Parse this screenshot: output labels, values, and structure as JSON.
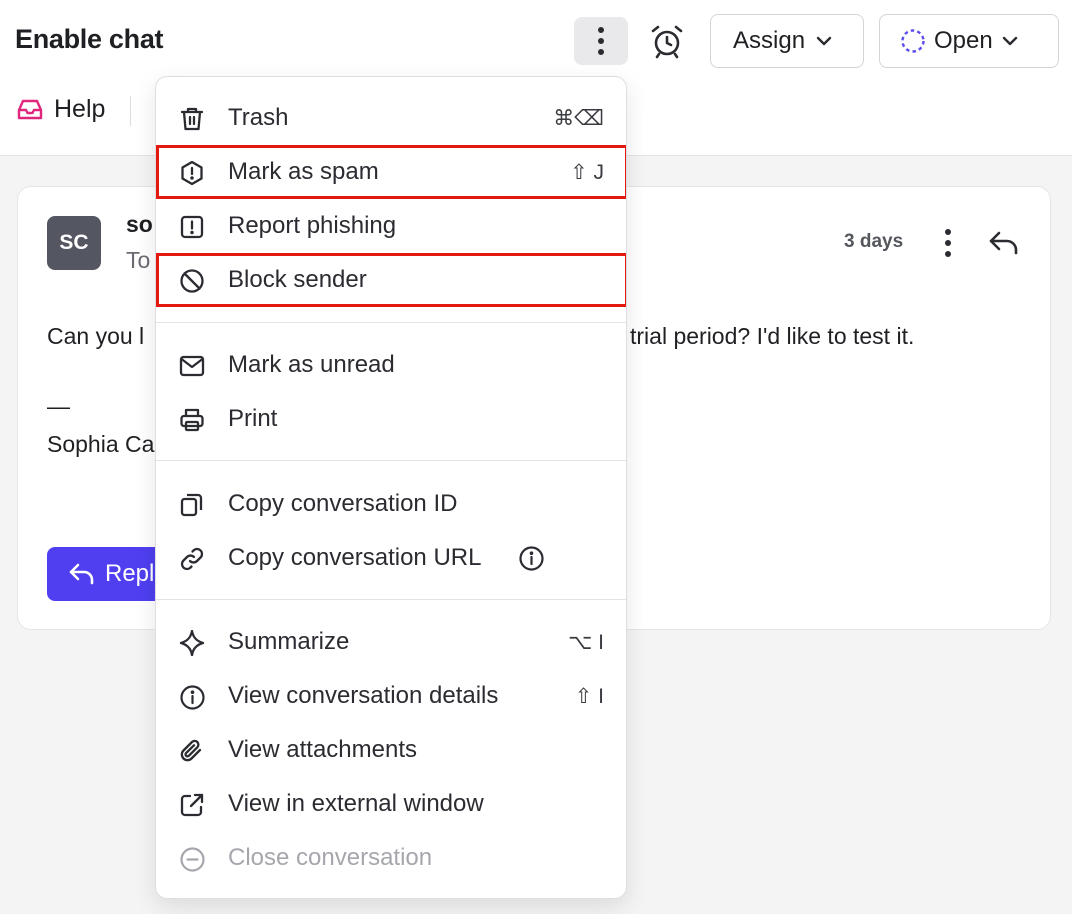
{
  "header": {
    "title": "Enable chat",
    "assign_label": "Assign",
    "status_label": "Open",
    "status_color": "#5b4cf0"
  },
  "tabs": {
    "inbox_label": "Help",
    "inbox_icon_color": "#e0267d"
  },
  "message": {
    "avatar_initials": "SC",
    "sender_partial": "so",
    "to_partial": "To",
    "time": "3 days",
    "body_start": "Can you l",
    "body_end": "trial period? I'd like to test it.",
    "signature_dash": "—",
    "signature_name": "Sophia Ca",
    "reply_label": "Repl",
    "reply_button_color": "#4f3ff0"
  },
  "menu": {
    "items": [
      {
        "label": "Trash",
        "icon": "trash-icon",
        "shortcut": "⌘⌫"
      },
      {
        "label": "Mark as spam",
        "icon": "spam-icon",
        "shortcut": "⇧ J",
        "highlighted": true
      },
      {
        "label": "Report phishing",
        "icon": "report-icon"
      },
      {
        "label": "Block sender",
        "icon": "block-icon",
        "highlighted": true
      },
      {
        "label": "Mark as unread",
        "icon": "mail-icon"
      },
      {
        "label": "Print",
        "icon": "printer-icon"
      },
      {
        "label": "Copy conversation ID",
        "icon": "copy-icon"
      },
      {
        "label": "Copy conversation URL",
        "icon": "link-icon"
      },
      {
        "label": "Summarize",
        "icon": "sparkle-icon",
        "shortcut": "⌥ I"
      },
      {
        "label": "View conversation details",
        "icon": "info-icon",
        "shortcut": "⇧ I"
      },
      {
        "label": "View attachments",
        "icon": "paperclip-icon"
      },
      {
        "label": "View in external window",
        "icon": "external-link-icon"
      },
      {
        "label": "Close conversation",
        "icon": "minus-circle-icon",
        "disabled": true
      }
    ],
    "highlight_color": "#e3190f"
  }
}
